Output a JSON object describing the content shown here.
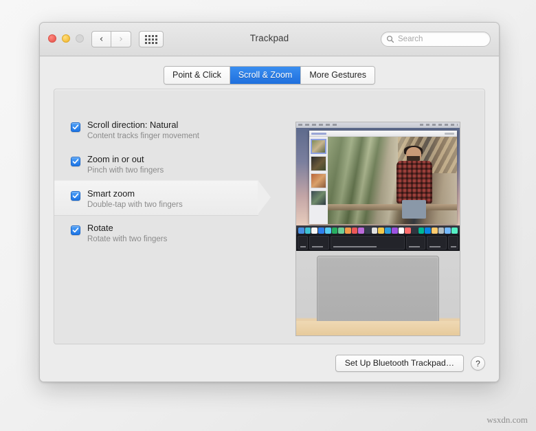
{
  "window": {
    "title": "Trackpad",
    "traffic_lights": [
      "close",
      "minimize",
      "zoom"
    ],
    "nav": {
      "back_icon": "chevron-left-icon",
      "forward_icon": "chevron-right-icon",
      "grid_icon": "grid-view-icon"
    },
    "search": {
      "placeholder": "Search",
      "value": "",
      "icon": "search-icon"
    }
  },
  "tabs": [
    {
      "label": "Point & Click",
      "active": false
    },
    {
      "label": "Scroll & Zoom",
      "active": true
    },
    {
      "label": "More Gestures",
      "active": false
    }
  ],
  "options": [
    {
      "title": "Scroll direction: Natural",
      "subtitle": "Content tracks finger movement",
      "checked": true,
      "selected": false
    },
    {
      "title": "Zoom in or out",
      "subtitle": "Pinch with two fingers",
      "checked": true,
      "selected": false
    },
    {
      "title": "Smart zoom",
      "subtitle": "Double-tap with two fingers",
      "checked": true,
      "selected": true
    },
    {
      "title": "Rotate",
      "subtitle": "Rotate with two fingers",
      "checked": true,
      "selected": false
    }
  ],
  "preview": {
    "name": "gesture-demo-video",
    "description": "MacBook showing Photos app on screen above a trackpad"
  },
  "footer": {
    "setup_button": "Set Up Bluetooth Trackpad…",
    "help_button": "?"
  },
  "watermark": "wsxdn.com",
  "colors": {
    "accent": "#1f6fdd",
    "checkbox": "#2b7df0",
    "window_bg": "#ececec",
    "panel_bg": "#e4e4e4"
  }
}
